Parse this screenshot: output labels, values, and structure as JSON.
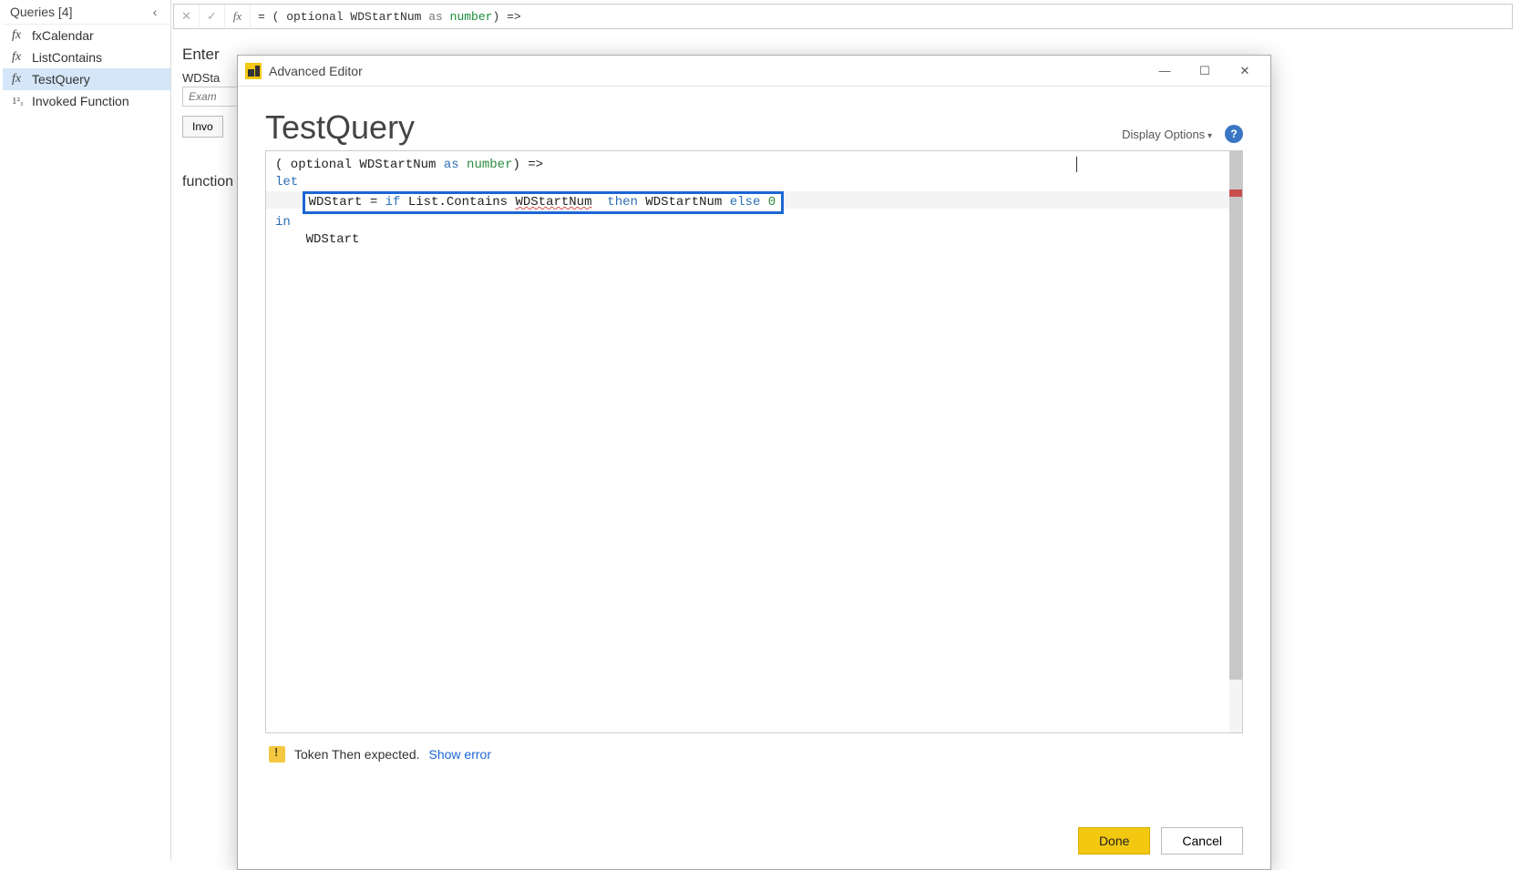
{
  "queries": {
    "header": "Queries [4]",
    "items": [
      {
        "icon": "fx",
        "label": "fxCalendar"
      },
      {
        "icon": "fx",
        "label": "ListContains"
      },
      {
        "icon": "fx",
        "label": "TestQuery",
        "selected": true
      },
      {
        "icon": "1²₃",
        "label": "Invoked Function"
      }
    ]
  },
  "formula_bar": {
    "prefix": "= ( optional WDStartNum ",
    "kw_as": "as",
    "type": "number",
    "suffix": ") =>"
  },
  "bg": {
    "enter": "Enter",
    "field": "WDSta",
    "placeholder": "Exam",
    "invoke": "Invo",
    "function": "function"
  },
  "modal": {
    "title": "Advanced Editor",
    "heading": "TestQuery",
    "display_options": "Display Options",
    "help": "?",
    "code": {
      "line1_a": "( optional WDStartNum ",
      "line1_as": "as",
      "line1_type": " number",
      "line1_b": ") =>",
      "line2": "let",
      "line3_a": "WDStart = ",
      "line3_if": "if",
      "line3_b": " List.Contains ",
      "line3_err": "WDStartNum",
      "line3_sp": "  ",
      "line3_then": "then",
      "line3_c": " WDStartNum ",
      "line3_else": "else",
      "line3_zero": " 0",
      "line4": "in",
      "line5": "WDStart"
    },
    "error": "Token Then expected.",
    "show_error": "Show error",
    "done": "Done",
    "cancel": "Cancel"
  }
}
